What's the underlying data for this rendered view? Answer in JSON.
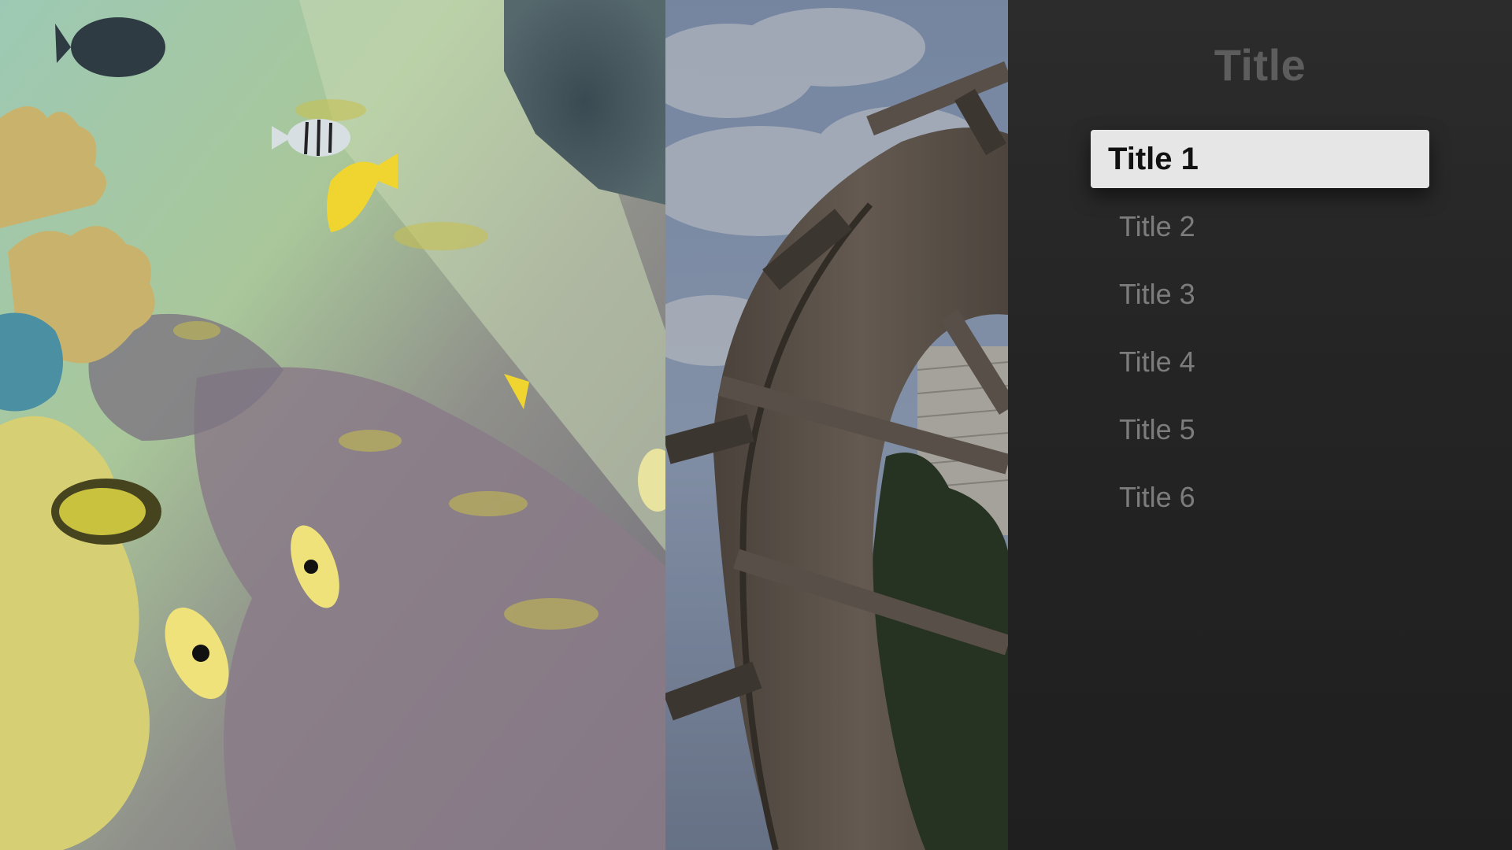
{
  "menu": {
    "title": "Title",
    "items": [
      {
        "label": "Title 1",
        "focused": true
      },
      {
        "label": "Title 2",
        "focused": false
      },
      {
        "label": "Title 3",
        "focused": false
      },
      {
        "label": "Title 4",
        "focused": false
      },
      {
        "label": "Title 5",
        "focused": false
      },
      {
        "label": "Title 6",
        "focused": false
      }
    ]
  },
  "colors": {
    "panel_background": "#262626",
    "title_text": "#5d5d5d",
    "item_text": "#7c7c7c",
    "focused_background": "#e6e6e6",
    "focused_text": "#111111"
  }
}
